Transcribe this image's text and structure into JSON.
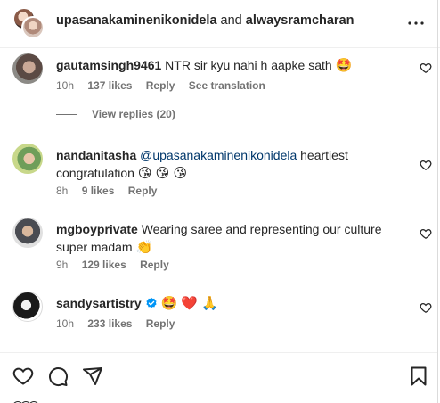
{
  "header": {
    "user1": "upasanakaminenikonidela",
    "joiner": "and",
    "user2": "alwaysramcharan"
  },
  "comments": [
    {
      "username": "gautamsingh9461",
      "text": "NTR sir kyu nahi h aapke sath",
      "emojis": "🤩",
      "time": "10h",
      "likes": "137 likes",
      "reply": "Reply",
      "translate": "See translation"
    },
    {
      "username": "nandanitasha",
      "mention": "@upasanakaminenikonidela",
      "text": "heartiest congratulation",
      "emojis": "😘 😘 😘",
      "time": "8h",
      "likes": "9 likes",
      "reply": "Reply"
    },
    {
      "username": "mgboyprivate",
      "text": "Wearing saree and representing our culture super madam",
      "emojis": "👏",
      "time": "9h",
      "likes": "129 likes",
      "reply": "Reply"
    },
    {
      "username": "sandysartistry",
      "text": "",
      "emojis": "🤩 ❤️ 🙏",
      "time": "10h",
      "likes": "233 likes",
      "reply": "Reply"
    }
  ],
  "view_replies": "View replies (20)",
  "icons": {
    "more": "more-horizontal-icon",
    "like": "heart-icon",
    "comment": "comment-icon",
    "share": "share-icon",
    "save": "bookmark-icon"
  },
  "colors": {
    "text": "#262626",
    "muted": "#737373",
    "mention": "#00376b",
    "verified": "#0095f6"
  }
}
